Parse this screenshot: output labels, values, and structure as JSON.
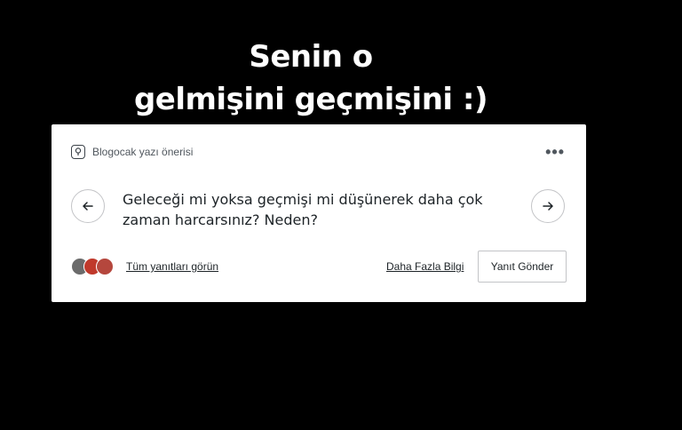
{
  "caption": {
    "line1": "Senin o",
    "line2": "gelmişini geçmişini :)"
  },
  "card": {
    "header_label": "Blogocak yazı önerisi",
    "more_icon": "more-horizontal-icon",
    "prev_icon": "arrow-left-icon",
    "next_icon": "arrow-right-icon",
    "question": "Geleceği mi yoksa geçmişi mi düşünerek daha çok zaman harcarsınız? Neden?",
    "all_answers_label": "Tüm yanıtları görün",
    "learn_more_label": "Daha Fazla Bilgi",
    "reply_label": "Yanıt Gönder",
    "avatar_colors": [
      "#6b6b6b",
      "#c0392b",
      "#b5473d"
    ]
  }
}
